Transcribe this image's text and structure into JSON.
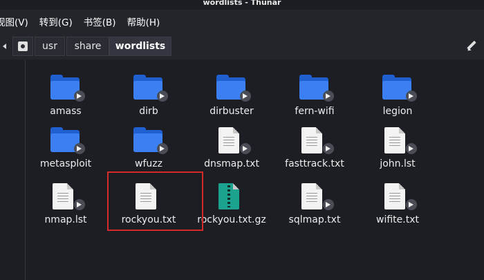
{
  "window": {
    "title": "wordlists - Thunar"
  },
  "menu": [
    {
      "label": "视图(V)"
    },
    {
      "label": "转到(G)"
    },
    {
      "label": "书签(B)"
    },
    {
      "label": "帮助(H)"
    }
  ],
  "path": {
    "crumbs": [
      "usr",
      "share",
      "wordlists"
    ],
    "active": "wordlists"
  },
  "icons": {
    "folder": "folder-icon",
    "text_file": "text-file-icon",
    "archive": "archive-icon",
    "symlink": "symlink-emblem-icon",
    "home": "filesystem-icon",
    "edit": "pencil-icon",
    "back": "chevron-left-icon"
  },
  "files": [
    {
      "name": "amass",
      "type": "folder",
      "symlink": true
    },
    {
      "name": "dirb",
      "type": "folder",
      "symlink": true
    },
    {
      "name": "dirbuster",
      "type": "folder",
      "symlink": true
    },
    {
      "name": "fern-wifi",
      "type": "folder",
      "symlink": true
    },
    {
      "name": "legion",
      "type": "folder",
      "symlink": true
    },
    {
      "name": "metasploit",
      "type": "folder",
      "symlink": true
    },
    {
      "name": "wfuzz",
      "type": "folder",
      "symlink": true
    },
    {
      "name": "dnsmap.txt",
      "type": "text",
      "symlink": true
    },
    {
      "name": "fasttrack.txt",
      "type": "text",
      "symlink": true
    },
    {
      "name": "john.lst",
      "type": "text",
      "symlink": true
    },
    {
      "name": "nmap.lst",
      "type": "text",
      "symlink": true
    },
    {
      "name": "rockyou.txt",
      "type": "text",
      "symlink": false
    },
    {
      "name": "rockyou.txt.gz",
      "type": "archive",
      "symlink": false
    },
    {
      "name": "sqlmap.txt",
      "type": "text",
      "symlink": true
    },
    {
      "name": "wifite.txt",
      "type": "text",
      "symlink": true
    }
  ],
  "highlight_color": "#d62a2a"
}
